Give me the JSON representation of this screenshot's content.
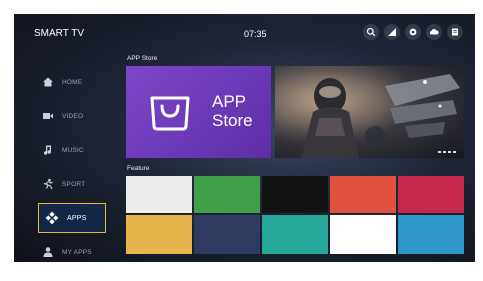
{
  "header": {
    "title": "SMART TV",
    "time": "07:35"
  },
  "top_icons": [
    {
      "icon": "search-icon"
    },
    {
      "icon": "signal-icon"
    },
    {
      "icon": "settings-icon"
    },
    {
      "icon": "cloud-icon"
    },
    {
      "icon": "inbox-icon"
    }
  ],
  "sidebar": {
    "items": [
      {
        "icon": "home-icon",
        "label": "HOME"
      },
      {
        "icon": "video-icon",
        "label": "VIDEO"
      },
      {
        "icon": "music-icon",
        "label": "MUSIC"
      },
      {
        "icon": "sport-icon",
        "label": "SPORT"
      },
      {
        "icon": "apps-icon",
        "label": "APPS",
        "active": true
      },
      {
        "icon": "user-icon",
        "label": "MY APPS"
      }
    ]
  },
  "app_store": {
    "section_label": "APP Store",
    "tile_text_line1": "APP",
    "tile_text_line2": "Store"
  },
  "feature": {
    "section_label": "Feature"
  },
  "colors": {
    "accent_border": "#e3bd34",
    "app_store_tile": "#7b47c8",
    "feature_cells": [
      "#ededed",
      "#3fa048",
      "#121212",
      "#e0513f",
      "#c6294c",
      "#e8b54c",
      "#2f3a60",
      "#25a898",
      "#ffffff",
      "#2d97c9"
    ]
  }
}
